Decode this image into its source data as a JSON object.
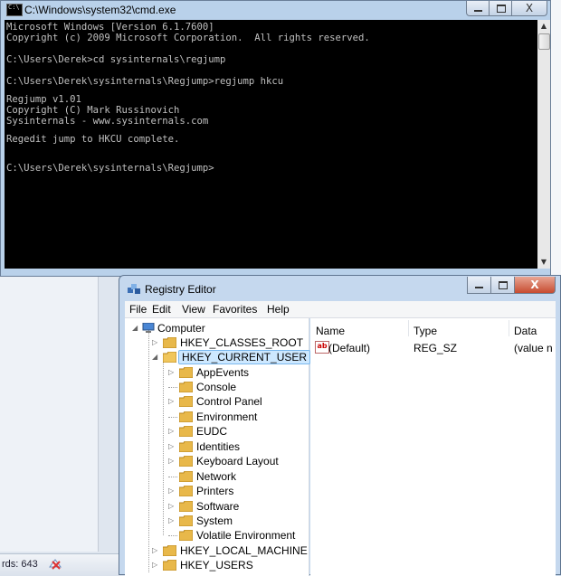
{
  "cmd": {
    "title": "C:\\Windows\\system32\\cmd.exe",
    "lines": [
      "Microsoft Windows [Version 6.1.7600]",
      "Copyright (c) 2009 Microsoft Corporation.  All rights reserved.",
      "",
      "C:\\Users\\Derek>cd sysinternals\\regjump",
      "",
      "C:\\Users\\Derek\\sysinternals\\Regjump>regjump hkcu",
      "",
      "Regjump v1.01",
      "Copyright (C) Mark Russinovich",
      "Sysinternals - www.sysinternals.com",
      "",
      "Regedit jump to HKCU complete.",
      "",
      "",
      "C:\\Users\\Derek\\sysinternals\\Regjump>"
    ],
    "close_label": "X"
  },
  "background": {
    "status_text": "rds: 643"
  },
  "registry": {
    "title": "Registry Editor",
    "close_label": "X",
    "menu": [
      "File",
      "Edit",
      "View",
      "Favorites",
      "Help"
    ],
    "tree": {
      "root": "Computer",
      "hives": [
        "HKEY_CLASSES_ROOT",
        "HKEY_CURRENT_USER",
        "HKEY_LOCAL_MACHINE",
        "HKEY_USERS"
      ],
      "hkcu_children": [
        "AppEvents",
        "Console",
        "Control Panel",
        "Environment",
        "EUDC",
        "Identities",
        "Keyboard Layout",
        "Network",
        "Printers",
        "Software",
        "System",
        "Volatile Environment"
      ],
      "selected": "HKEY_CURRENT_USER"
    },
    "columns": [
      "Name",
      "Type",
      "Data"
    ],
    "values": [
      {
        "icon": "ab",
        "name": "(Default)",
        "type": "REG_SZ",
        "data": "(value n"
      }
    ],
    "colors": {
      "selection": "#cde8ff",
      "folder": "#e8b84a"
    }
  }
}
